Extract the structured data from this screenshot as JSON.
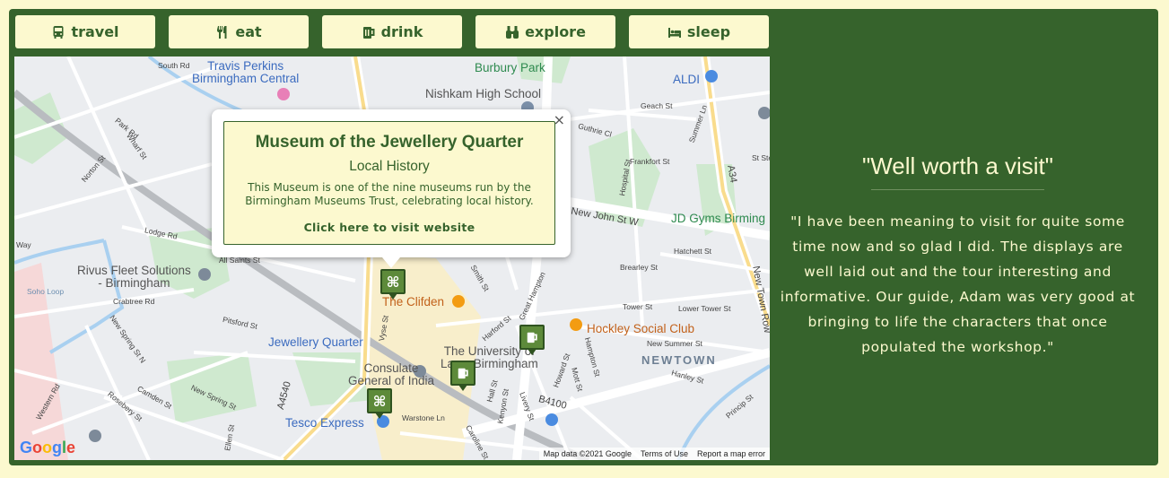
{
  "nav": {
    "travel": "travel",
    "eat": "eat",
    "drink": "drink",
    "explore": "explore",
    "sleep": "sleep"
  },
  "colors": {
    "accent": "#36632c",
    "cream": "#fcf9cf",
    "marker": "#5d8a3a"
  },
  "map": {
    "labels": {
      "travis": "Travis Perkins\nBirmingham Central",
      "burbury": "Burbury Park",
      "nishkam": "Nishkam High School",
      "aldi": "ALDI",
      "jdgyms": "JD Gyms Birming",
      "rivus": "Rivus Fleet Solutions\n- Birmingham",
      "clifden": "The Clifden",
      "hockley": "Hockley Social Club",
      "jq_station": "Jewellery Quarter",
      "uni": "The University of\nLaw - Birmingham",
      "consulate": "Consulate\nGeneral of India",
      "tesco": "Tesco Express",
      "newtown": "NEWTOWN",
      "soho_loop": "Soho Loop"
    },
    "streets": [
      "South Rd",
      "Park Rd",
      "Wharf St",
      "Norton St",
      "Lodge Rd",
      "All Saints St",
      "Crabtree Rd",
      "New Spring St N",
      "Pitsford St",
      "Western Rd",
      "Rosebery St",
      "Camden St",
      "New Spring St",
      "Vyse St",
      "A4540",
      "Warstone Ln",
      "Harford St",
      "Great Hampton",
      "Smith St",
      "Hall St",
      "Kenyon St",
      "Livery St",
      "B4100",
      "Howard St",
      "Hampton St",
      "Mott St",
      "New John St W",
      "Frankfort St",
      "Hospital St",
      "Geach St",
      "Summer Ln",
      "A34",
      "New Town Row",
      "Hatchett St",
      "Brearley St",
      "Tower St",
      "Lower Tower St",
      "New Summer St",
      "Hanley St",
      "Princip St",
      "Guthrie Cl",
      "St Step",
      "Caroline St",
      "Ellen St",
      "Way"
    ],
    "google": "Google",
    "attribution": {
      "data": "Map data ©2021 Google",
      "terms": "Terms of Use",
      "report": "Report a map error"
    }
  },
  "infowindow": {
    "title": "Museum of the Jewellery Quarter",
    "category": "Local History",
    "description": "This Museum is one of the nine museums run by the Birmingham Museums Trust, celebrating local history.",
    "link": "Click here to visit website",
    "close": "×"
  },
  "review": {
    "title": "\"Well worth a visit\"",
    "text": "\"I have been meaning to visit for quite some time now and so glad I did. The displays are well laid out and the tour interesting and informative. Our guide, Adam was very good at bringing to life the characters that once populated the workshop.\""
  }
}
